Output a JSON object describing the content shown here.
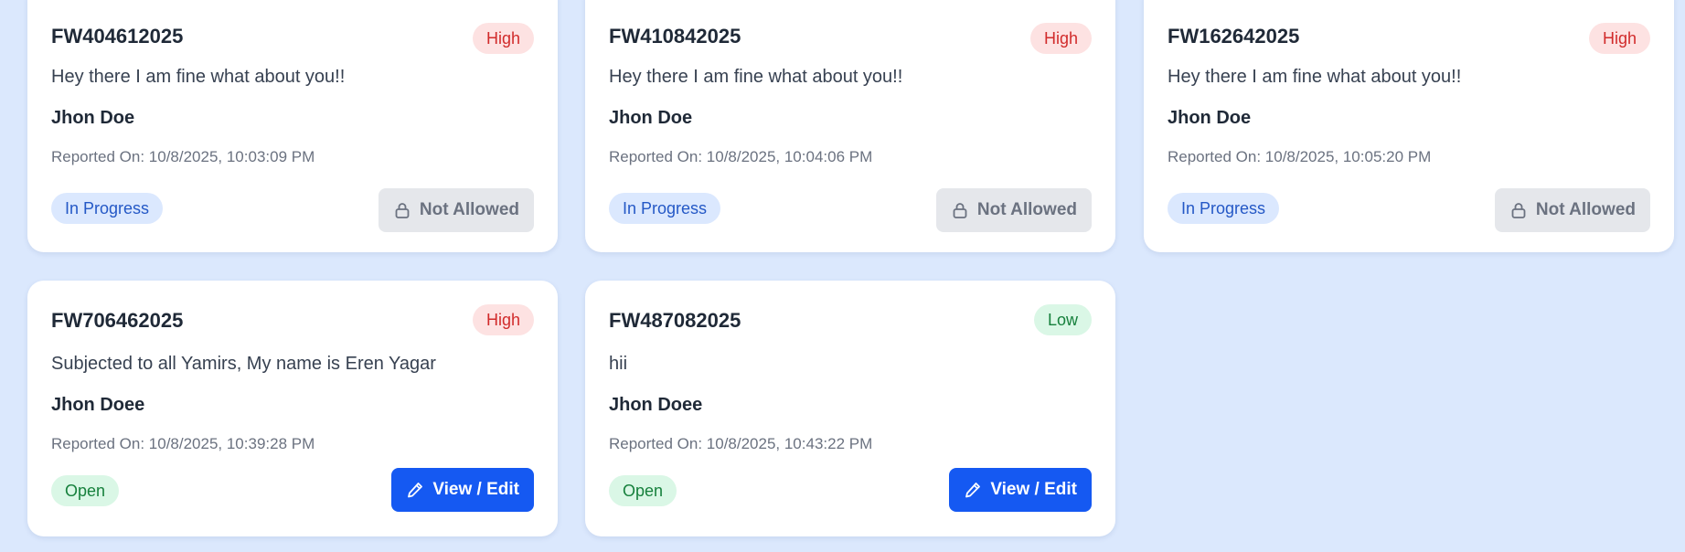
{
  "cards": [
    {
      "code": "FW404612025",
      "priority": "High",
      "message": "Hey there I am fine what about you!!",
      "reporter": "Jhon Doe",
      "reported_on": "Reported On: 10/8/2025, 10:03:09 PM",
      "status": "In Progress",
      "action": "Not Allowed",
      "action_icon": "lock-icon"
    },
    {
      "code": "FW410842025",
      "priority": "High",
      "message": "Hey there I am fine what about you!!",
      "reporter": "Jhon Doe",
      "reported_on": "Reported On: 10/8/2025, 10:04:06 PM",
      "status": "In Progress",
      "action": "Not Allowed",
      "action_icon": "lock-icon"
    },
    {
      "code": "FW162642025",
      "priority": "High",
      "message": "Hey there I am fine what about you!!",
      "reporter": "Jhon Doe",
      "reported_on": "Reported On: 10/8/2025, 10:05:20 PM",
      "status": "In Progress",
      "action": "Not Allowed",
      "action_icon": "lock-icon"
    },
    {
      "code": "FW706462025",
      "priority": "High",
      "message": "Subjected to all Yamirs, My name is Eren Yagar",
      "reporter": "Jhon Doee",
      "reported_on": "Reported On: 10/8/2025, 10:39:28 PM",
      "status": "Open",
      "action": "View / Edit",
      "action_icon": "pencil-icon"
    },
    {
      "code": "FW487082025",
      "priority": "Low",
      "message": "hii",
      "reporter": "Jhon Doee",
      "reported_on": "Reported On: 10/8/2025, 10:43:22 PM",
      "status": "Open",
      "action": "View / Edit",
      "action_icon": "pencil-icon"
    }
  ],
  "colors": {
    "page_bg": "#dbe8fd",
    "high_bg": "#fde2e2",
    "high_fg": "#d12b2b",
    "low_bg": "#daf7e6",
    "low_fg": "#16803c",
    "progress_bg": "#dbe8fe",
    "progress_fg": "#2458c6",
    "primary": "#1559f2",
    "disabled_bg": "#e5e7eb",
    "disabled_fg": "#6b7280"
  }
}
